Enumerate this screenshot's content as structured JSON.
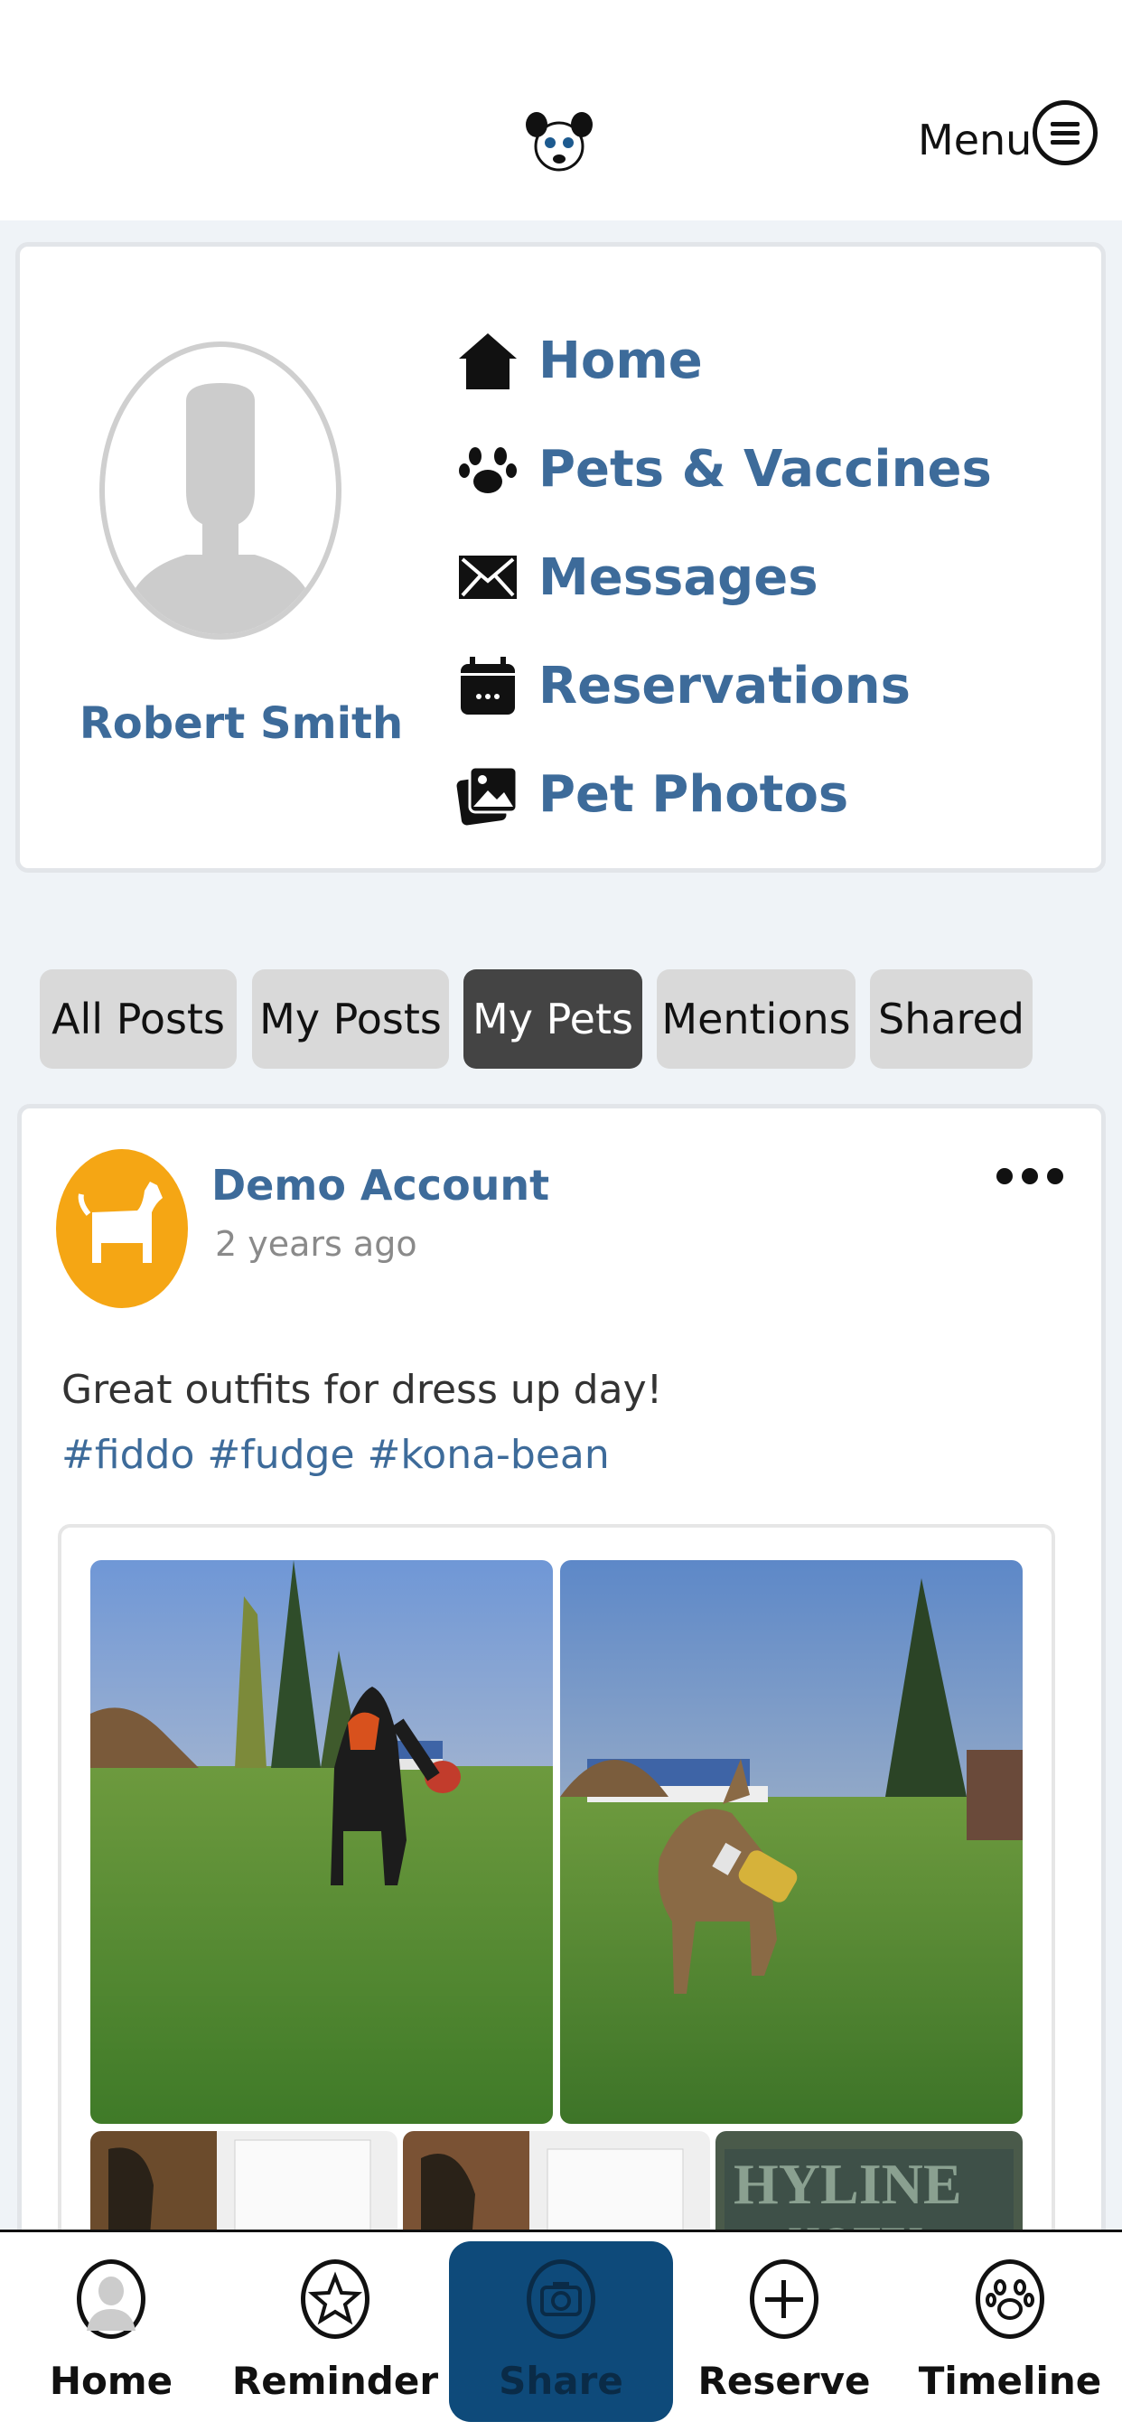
{
  "header": {
    "menu_label": "Menu"
  },
  "profile": {
    "user_name": "Robert Smith",
    "nav": [
      {
        "label": "Home",
        "icon": "house-icon"
      },
      {
        "label": "Pets & Vaccines",
        "icon": "paw-icon"
      },
      {
        "label": "Messages",
        "icon": "envelope-icon"
      },
      {
        "label": "Reservations",
        "icon": "calendar-icon"
      },
      {
        "label": "Pet Photos",
        "icon": "photos-icon"
      }
    ]
  },
  "tabs": [
    {
      "label": "All Posts",
      "active": false
    },
    {
      "label": "My Posts",
      "active": false
    },
    {
      "label": "My Pets",
      "active": true
    },
    {
      "label": "Mentions",
      "active": false
    },
    {
      "label": "Shared",
      "active": false
    }
  ],
  "post": {
    "author": "Demo Account",
    "time": "2 years ago",
    "text": "Great outfits for dress up day!",
    "tags": "#fiddo #fudge #kona-bean"
  },
  "bottom_nav": [
    {
      "label": "Home",
      "icon": "user-icon"
    },
    {
      "label": "Reminder",
      "icon": "star-icon"
    },
    {
      "label": "Share",
      "icon": "camera-icon"
    },
    {
      "label": "Reserve",
      "icon": "plus-icon"
    },
    {
      "label": "Timeline",
      "icon": "paw-icon"
    }
  ],
  "colors": {
    "accent_blue": "#3d6b9a",
    "share_bg": "#0e4a7a",
    "avatar_orange": "#f5a614",
    "active_tab": "#444444"
  }
}
